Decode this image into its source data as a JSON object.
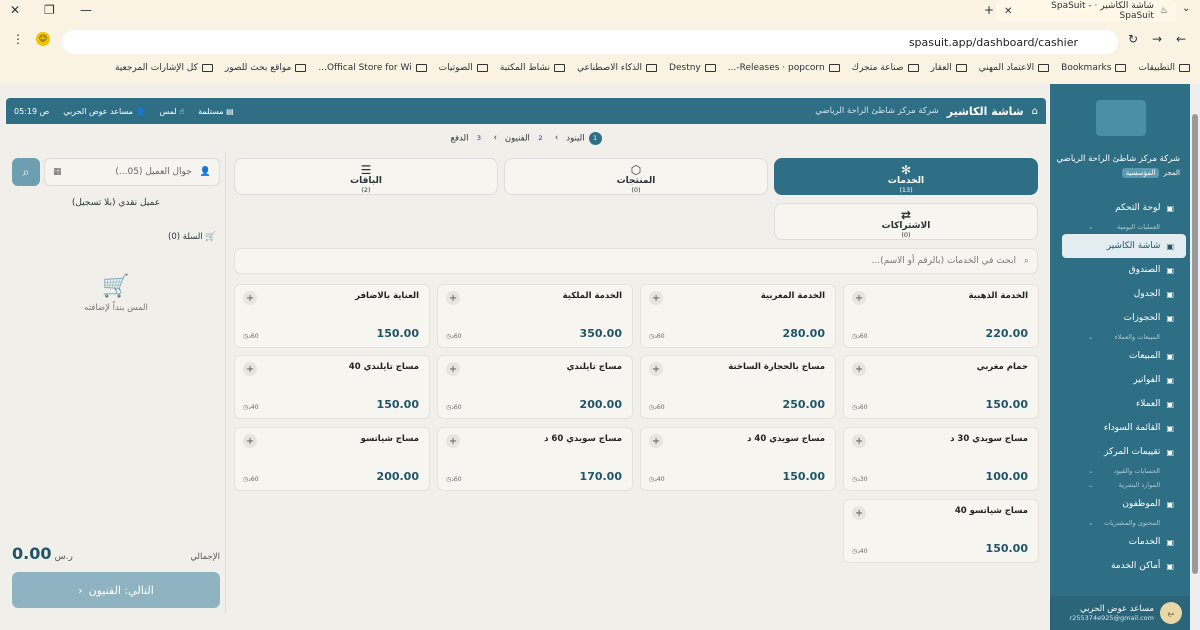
{
  "browser": {
    "tab_title": "شاشة الكاشير · SpaSuit - SpaSuit",
    "url": "spasuit.app/dashboard/cashier",
    "bookmarks": [
      "التطبيقات",
      "Bookmarks",
      "الاعتماد المهني",
      "العقار",
      "صناعة متجرك",
      "Releases · popcorn-...",
      "Destny",
      "الذكاء الاصطناعي",
      "نشاط المكتبة",
      "الصوتيات",
      "Offical Store for Wi...",
      "مواقع بحث للصور",
      "كل الإشارات المرجعية"
    ]
  },
  "sidebar": {
    "org_name": "شركة مركز شاطئ الراحة الرياضي",
    "org_role": "المجر",
    "org_badge": "المؤسسية",
    "items": [
      {
        "label": "لوحة التحكم",
        "icon": "dashboard-icon"
      },
      {
        "section": "العمليات اليومية"
      },
      {
        "label": "شاشة الكاشير",
        "icon": "store-icon",
        "active": true
      },
      {
        "label": "الصندوق",
        "icon": "cash-icon"
      },
      {
        "label": "الجدول",
        "icon": "calendar-icon"
      },
      {
        "label": "الحجوزات",
        "icon": "booking-icon"
      },
      {
        "section": "المبيعات والعملاء"
      },
      {
        "label": "المبيعات",
        "icon": "chart-icon"
      },
      {
        "label": "الفواتير",
        "icon": "invoice-icon"
      },
      {
        "label": "العملاء",
        "icon": "user-icon"
      },
      {
        "label": "القائمة السوداء",
        "icon": "block-icon"
      },
      {
        "label": "تقييمات المركز",
        "icon": "star-icon"
      },
      {
        "section": "الحسابات والقيود"
      },
      {
        "section": "الموارد البشرية"
      },
      {
        "label": "الموظفون",
        "icon": "staff-icon"
      },
      {
        "section": "المحتوى والمشتريات"
      },
      {
        "label": "الخدمات",
        "icon": "services-icon"
      },
      {
        "label": "أماكن الخدمة",
        "icon": "location-icon"
      }
    ],
    "user_name": "مساعد عوض الحربي",
    "user_email": "r255374e925@gmail.com",
    "user_avatar": "مع"
  },
  "header": {
    "title": "شاشة الكاشير",
    "subtitle": "شركة مركز شاطئ الراحة الرياضي",
    "status": "مستلمة",
    "touch": "لمس",
    "user": "مساعد عوض الحربي",
    "time": "ص 05:19"
  },
  "steps": [
    {
      "num": "1",
      "label": "البنود"
    },
    {
      "num": "2",
      "label": "الفنيون"
    },
    {
      "num": "3",
      "label": "الدفع"
    }
  ],
  "cart": {
    "customer_placeholder": "جوال العميل (05...)",
    "cash_customer": "عميل نقدي (بلا تسجيل)",
    "cart_label": "السلة (0)",
    "empty_text": "المس بنداً لإضافته",
    "total_label": "الإجمالي",
    "total_value": "0.00",
    "currency": "ر.س",
    "next_button": "التالي: الفنيون"
  },
  "tabs": [
    {
      "label": "الخدمات",
      "count": "(13)",
      "icon": "✻",
      "active": true
    },
    {
      "label": "المنتجات",
      "count": "(0)",
      "icon": "⬡"
    },
    {
      "label": "الباقات",
      "count": "(2)",
      "icon": "☰"
    },
    {
      "label": "الاشتراكات",
      "count": "(0)",
      "icon": "⇄"
    }
  ],
  "search_placeholder": "ابحث في الخدمات (بالرقم أو الاسم)...",
  "services": [
    {
      "name": "الخدمة الذهبية",
      "price": "220.00",
      "dur": "60د"
    },
    {
      "name": "الخدمة المغربية",
      "price": "280.00",
      "dur": "60د"
    },
    {
      "name": "الخدمة الملكية",
      "price": "350.00",
      "dur": "60د"
    },
    {
      "name": "العناية بالاضافر",
      "price": "150.00",
      "dur": "60د"
    },
    {
      "name": "حمام مغربي",
      "price": "150.00",
      "dur": "60د"
    },
    {
      "name": "مساج بالحجارة الساخنة",
      "price": "250.00",
      "dur": "60د"
    },
    {
      "name": "مساج تايلندي",
      "price": "200.00",
      "dur": "60د"
    },
    {
      "name": "مساج تايلندي 40",
      "price": "150.00",
      "dur": "40د"
    },
    {
      "name": "مساج سويدي 30 د",
      "price": "100.00",
      "dur": "30د"
    },
    {
      "name": "مساج سويدي 40 د",
      "price": "150.00",
      "dur": "40د"
    },
    {
      "name": "مساج سويدي 60 د",
      "price": "170.00",
      "dur": "60د"
    },
    {
      "name": "مساج شياتسو",
      "price": "200.00",
      "dur": "60د"
    },
    {
      "name": "مساج شياتسو 40",
      "price": "150.00",
      "dur": "40د"
    }
  ]
}
